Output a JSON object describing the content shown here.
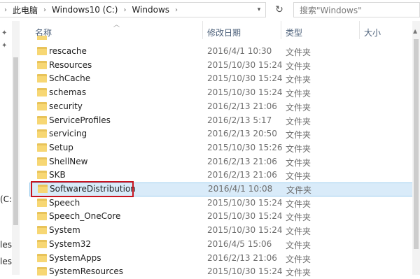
{
  "address": {
    "crumbs": [
      "此电脑",
      "Windows10 (C:)",
      "Windows"
    ],
    "search_placeholder": "搜索\"Windows\""
  },
  "nav": {
    "partial_labels": [
      "(C:",
      "les",
      "les"
    ]
  },
  "columns": {
    "name": "名称",
    "modified": "修改日期",
    "type": "类型",
    "size": "大小"
  },
  "rows": [
    {
      "name": "rescache",
      "date": "2016/4/1 10:30",
      "type": "文件夹"
    },
    {
      "name": "Resources",
      "date": "2015/10/30 15:24",
      "type": "文件夹"
    },
    {
      "name": "SchCache",
      "date": "2015/10/30 15:24",
      "type": "文件夹"
    },
    {
      "name": "schemas",
      "date": "2015/10/30 15:24",
      "type": "文件夹"
    },
    {
      "name": "security",
      "date": "2016/2/13 21:06",
      "type": "文件夹"
    },
    {
      "name": "ServiceProfiles",
      "date": "2016/2/13 5:17",
      "type": "文件夹"
    },
    {
      "name": "servicing",
      "date": "2016/2/13 20:50",
      "type": "文件夹"
    },
    {
      "name": "Setup",
      "date": "2015/10/30 15:26",
      "type": "文件夹"
    },
    {
      "name": "ShellNew",
      "date": "2016/2/13 21:06",
      "type": "文件夹"
    },
    {
      "name": "SKB",
      "date": "2016/2/13 21:06",
      "type": "文件夹"
    },
    {
      "name": "SoftwareDistribution",
      "date": "2016/4/1 10:08",
      "type": "文件夹",
      "selected": true
    },
    {
      "name": "Speech",
      "date": "2015/10/30 15:24",
      "type": "文件夹"
    },
    {
      "name": "Speech_OneCore",
      "date": "2015/10/30 15:24",
      "type": "文件夹"
    },
    {
      "name": "System",
      "date": "2015/10/30 15:24",
      "type": "文件夹"
    },
    {
      "name": "System32",
      "date": "2016/4/5 15:06",
      "type": "文件夹"
    },
    {
      "name": "SystemApps",
      "date": "2016/2/13 21:06",
      "type": "文件夹"
    },
    {
      "name": "SystemResources",
      "date": "2015/10/30 15:24",
      "type": "文件夹"
    }
  ],
  "colors": {
    "selection_bg": "#d9ebf9",
    "highlight_border": "#c9141e",
    "folder": "#f7d774"
  }
}
